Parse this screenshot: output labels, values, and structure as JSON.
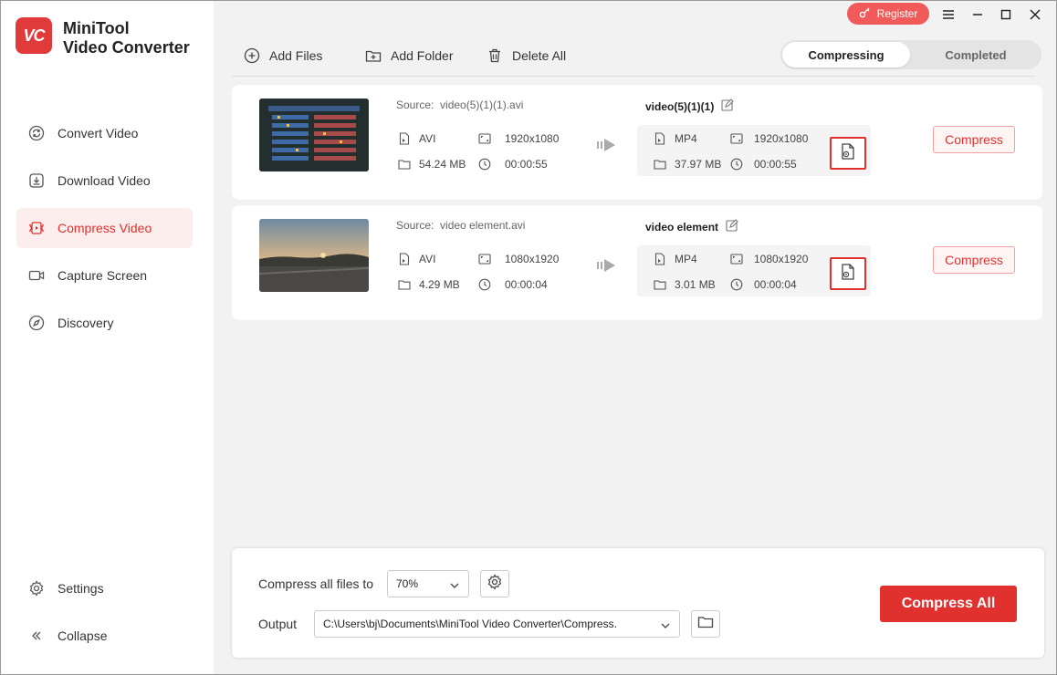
{
  "app": {
    "logo_text": "VC",
    "title_line1": "MiniTool",
    "title_line2": "Video Converter"
  },
  "sidebar": {
    "items": [
      {
        "label": "Convert Video",
        "icon": "convert-icon"
      },
      {
        "label": "Download Video",
        "icon": "download-icon"
      },
      {
        "label": "Compress Video",
        "icon": "compress-icon",
        "active": true
      },
      {
        "label": "Capture Screen",
        "icon": "camera-icon"
      },
      {
        "label": "Discovery",
        "icon": "compass-icon"
      }
    ],
    "settings_label": "Settings",
    "collapse_label": "Collapse"
  },
  "titlebar": {
    "register_label": "Register"
  },
  "toolbar": {
    "add_files": "Add Files",
    "add_folder": "Add Folder",
    "delete_all": "Delete All"
  },
  "tabs": {
    "compressing": "Compressing",
    "completed": "Completed"
  },
  "files": [
    {
      "source_label": "Source:",
      "source_name": "video(5)(1)(1).avi",
      "src_format": "AVI",
      "src_resolution": "1920x1080",
      "src_size": "54.24 MB",
      "src_duration": "00:00:55",
      "out_name": "video(5)(1)(1)",
      "out_format": "MP4",
      "out_resolution": "1920x1080",
      "out_size": "37.97 MB",
      "out_duration": "00:00:55",
      "compress_label": "Compress"
    },
    {
      "source_label": "Source:",
      "source_name": "video element.avi",
      "src_format": "AVI",
      "src_resolution": "1080x1920",
      "src_size": "4.29 MB",
      "src_duration": "00:00:04",
      "out_name": "video element",
      "out_format": "MP4",
      "out_resolution": "1080x1920",
      "out_size": "3.01 MB",
      "out_duration": "00:00:04",
      "compress_label": "Compress"
    }
  ],
  "bottom": {
    "compress_all_label": "Compress all files to",
    "ratio_value": "70%",
    "output_label": "Output",
    "output_path": "C:\\Users\\bj\\Documents\\MiniTool Video Converter\\Compress.",
    "compress_all_button": "Compress All"
  },
  "colors": {
    "accent": "#e0312f",
    "register": "#f05a5a",
    "active_nav_bg": "#fdeeee"
  }
}
